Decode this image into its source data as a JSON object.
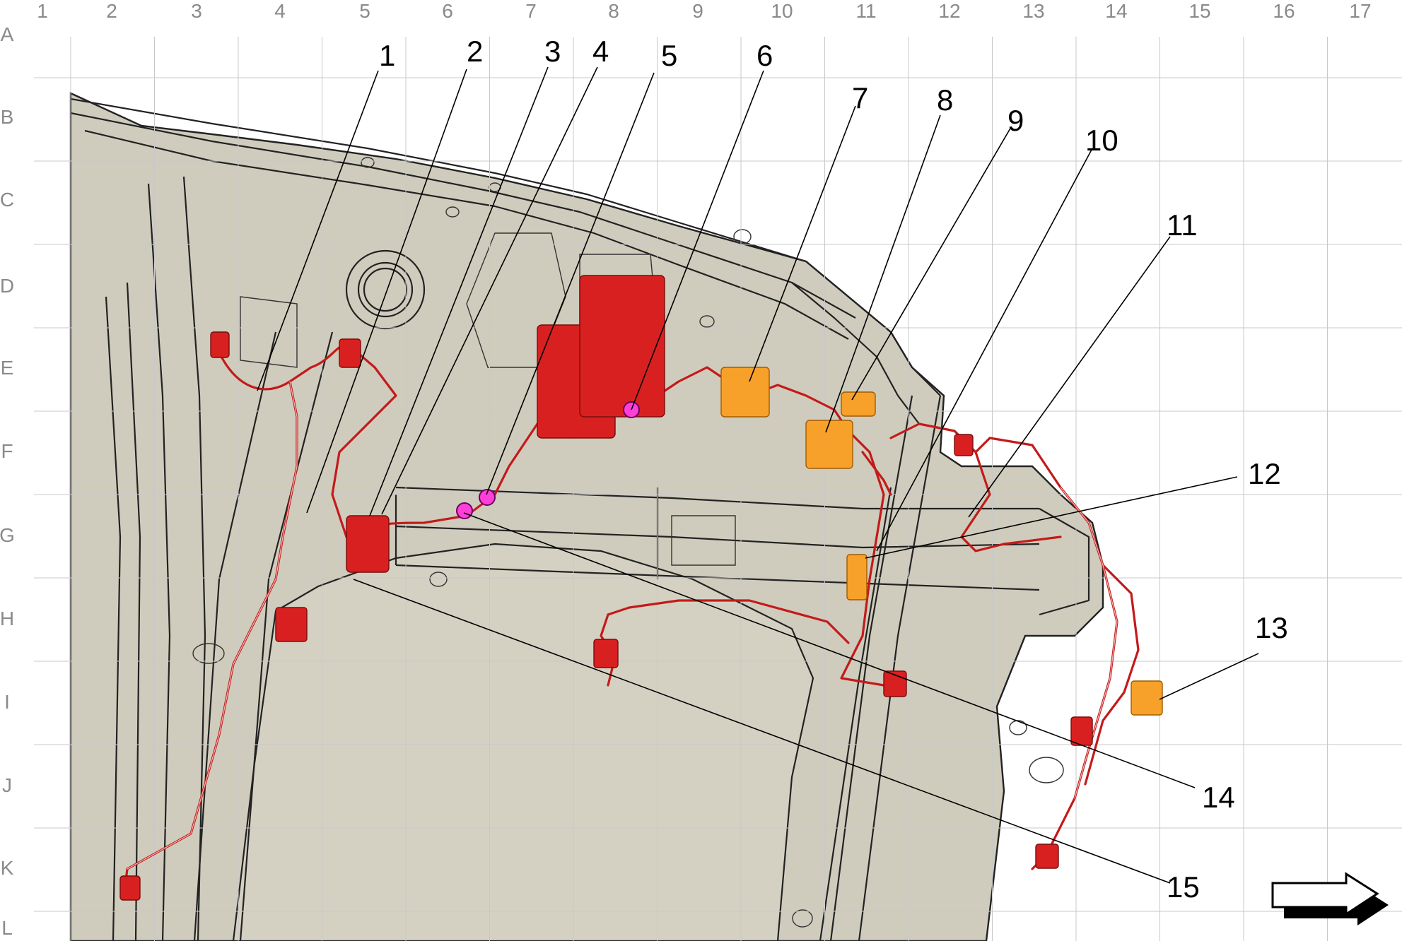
{
  "grid": {
    "columns": [
      "1",
      "2",
      "3",
      "4",
      "5",
      "6",
      "7",
      "8",
      "9",
      "10",
      "11",
      "12",
      "13",
      "14",
      "15",
      "16",
      "17"
    ],
    "rows": [
      "A",
      "B",
      "C",
      "D",
      "E",
      "F",
      "G",
      "H",
      "I",
      "J",
      "K",
      "L"
    ]
  },
  "callouts": [
    "1",
    "2",
    "3",
    "4",
    "5",
    "6",
    "7",
    "8",
    "9",
    "10",
    "11",
    "12",
    "13",
    "14",
    "15"
  ],
  "colors": {
    "harness": "#c41a1a",
    "connector_red": "#d92020",
    "connector_orange": "#f7a12a",
    "ground_point": "#ff3fd8",
    "body_fill": "#cfccbd",
    "grid_line": "#c8c8c8"
  },
  "icons": {
    "direction": "right-arrow-icon"
  }
}
